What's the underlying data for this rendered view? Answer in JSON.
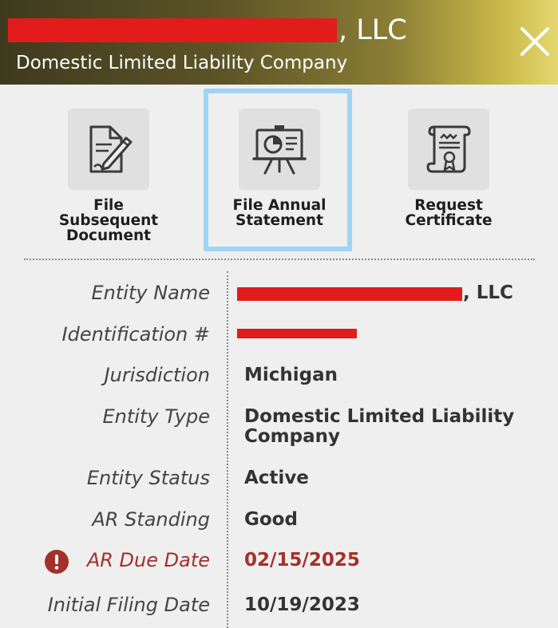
{
  "header": {
    "title_suffix": ", LLC",
    "subtitle": "Domestic Limited Liability Company",
    "close_icon": "close-icon",
    "gradient_colors": [
      "#3e3a1e",
      "#8a7d35",
      "#e6d870"
    ]
  },
  "actions": [
    {
      "label": "File Subsequent Document",
      "icon": "document-edit-icon",
      "selected": false
    },
    {
      "label": "File Annual Statement",
      "icon": "presentation-chart-icon",
      "selected": true
    },
    {
      "label": "Request Certificate",
      "icon": "certificate-scroll-icon",
      "selected": false
    }
  ],
  "details": {
    "entity_name": {
      "label": "Entity Name",
      "value_suffix": ", LLC"
    },
    "identification": {
      "label": "Identification #"
    },
    "jurisdiction": {
      "label": "Jurisdiction",
      "value": "Michigan"
    },
    "entity_type": {
      "label": "Entity Type",
      "value_line1": "Domestic Limited Liability",
      "value_line2": "Company"
    },
    "entity_status": {
      "label": "Entity Status",
      "value": "Active"
    },
    "ar_standing": {
      "label": "AR Standing",
      "value": "Good"
    },
    "ar_due_date": {
      "label": "AR Due Date",
      "value": "02/15/2025",
      "warning_icon": "exclamation-circle-icon",
      "color": "#a3302a"
    },
    "initial_filing_date": {
      "label": "Initial Filing Date",
      "value": "10/19/2023"
    }
  },
  "colors": {
    "redaction": "#e21b1b",
    "selection_frame": "#9fd4f5",
    "background": "#efefef"
  }
}
